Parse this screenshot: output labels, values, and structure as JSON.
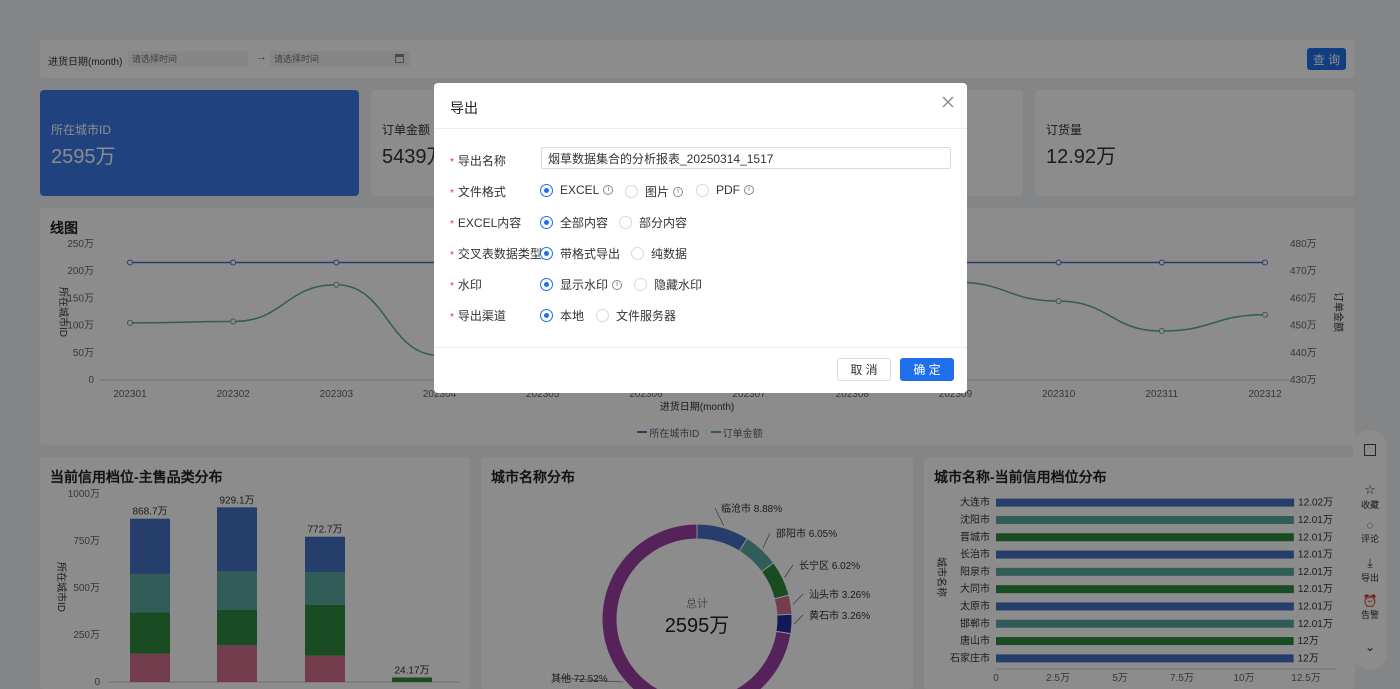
{
  "filter": {
    "label": "进货日期(month)",
    "start_placeholder": "请选择时间",
    "end_placeholder": "请选择时间",
    "arrow": "→",
    "query_button": "查 询"
  },
  "kpis": [
    {
      "label": "所在城市ID",
      "value": "2595万"
    },
    {
      "label": "订单金额",
      "value": "5439万"
    },
    {
      "label": "订货量",
      "value": "12.92万"
    }
  ],
  "line_panel": {
    "title": "线图",
    "y_left_label": "所在城市ID",
    "y_right_label": "订单金额",
    "x_label": "进货日期(month)",
    "legend": [
      "所在城市ID",
      "订单金额"
    ]
  },
  "stack_panel": {
    "title": "当前信用档位-主售品类分布",
    "y_label": "所在城市ID",
    "bar_labels": [
      "868.7万",
      "929.1万",
      "772.7万",
      "24.17万"
    ]
  },
  "donut_panel": {
    "title": "城市名称分布",
    "center_label": "总计",
    "center_value": "2595万",
    "labels": [
      "临沧市 8.88%",
      "邵阳市 6.05%",
      "长宁区 6.02%",
      "汕头市 3.26%",
      "黄石市 3.26%",
      "其他 72.52%"
    ]
  },
  "hbar_panel": {
    "title": "城市名称-当前信用档位分布",
    "y_label": "城市名称"
  },
  "side_tools": [
    {
      "icon": "edit-icon",
      "label": ""
    },
    {
      "icon": "star-icon",
      "label": "收藏"
    },
    {
      "icon": "comment-icon",
      "label": "评论"
    },
    {
      "icon": "download-icon",
      "label": "导出"
    },
    {
      "icon": "alarm-icon",
      "label": "告警"
    },
    {
      "icon": "chevron-down-icon",
      "label": ""
    }
  ],
  "modal": {
    "title": "导出",
    "fields": [
      {
        "label": "导出名称",
        "value": "烟草数据集合的分析报表_20250314_1517"
      },
      {
        "label": "文件格式",
        "options": [
          "EXCEL",
          "图片",
          "PDF"
        ],
        "selected": 0
      },
      {
        "label": "EXCEL内容",
        "options": [
          "全部内容",
          "部分内容"
        ],
        "selected": 0
      },
      {
        "label": "交叉表数据类型",
        "options": [
          "带格式导出",
          "纯数据"
        ],
        "selected": 0
      },
      {
        "label": "水印",
        "options": [
          "显示水印",
          "隐藏水印"
        ],
        "selected": 0
      },
      {
        "label": "导出渠道",
        "options": [
          "本地",
          "文件服务器"
        ],
        "selected": 0
      }
    ],
    "cancel": "取 消",
    "confirm": "确 定"
  },
  "colors": {
    "primary": "#1f6fec",
    "series_blue": "#4472c4",
    "series_teal": "#5aa89e",
    "series_green": "#2e8b3e",
    "series_pink": "#d4708f",
    "donut_purple": "#9b3fa5",
    "donut_navy": "#1f2fa0"
  },
  "chart_data": [
    {
      "type": "line",
      "title": "线图",
      "x": [
        "202301",
        "202302",
        "202303",
        "202304",
        "202305",
        "202306",
        "202307",
        "202308",
        "202309",
        "202310",
        "202311",
        "202312"
      ],
      "xlabel": "进货日期(month)",
      "ylabel": "所在城市ID",
      "y2label": "订单金额",
      "yticks": [
        "0",
        "50万",
        "100万",
        "150万",
        "200万",
        "250万"
      ],
      "y2ticks": [
        "430万",
        "440万",
        "450万",
        "460万",
        "470万",
        "480万"
      ],
      "ylim": [
        0,
        250
      ],
      "y2lim": [
        430,
        480
      ],
      "series": [
        {
          "name": "所在城市ID",
          "axis": "left",
          "values": [
            216,
            216,
            216,
            216,
            216,
            216,
            216,
            216,
            216,
            216,
            216,
            216
          ]
        },
        {
          "name": "订单金额",
          "axis": "right",
          "values": [
            451,
            451.5,
            465,
            439,
            443,
            446,
            448,
            450,
            466,
            459,
            448,
            454
          ]
        }
      ],
      "legend_position": "bottom"
    },
    {
      "type": "bar",
      "title": "当前信用档位-主售品类分布",
      "ylabel": "所在城市ID",
      "yticks": [
        "0",
        "250万",
        "500万",
        "750万",
        "1000万"
      ],
      "ylim": [
        0,
        1000
      ],
      "stacked": true,
      "totals": [
        868.7,
        929.1,
        772.7,
        24.17
      ],
      "series": [
        {
          "values": [
            150,
            195,
            140,
            0
          ]
        },
        {
          "values": [
            220,
            190,
            270,
            24.17
          ]
        },
        {
          "values": [
            205,
            205,
            175,
            0
          ]
        },
        {
          "values": [
            293.7,
            339.1,
            187.7,
            0
          ]
        }
      ]
    },
    {
      "type": "pie",
      "title": "城市名称分布",
      "slices": [
        {
          "label": "临沧市",
          "value": 8.88
        },
        {
          "label": "邵阳市",
          "value": 6.05
        },
        {
          "label": "长宁区",
          "value": 6.02
        },
        {
          "label": "汕头市",
          "value": 3.26
        },
        {
          "label": "黄石市",
          "value": 3.26
        },
        {
          "label": "其他",
          "value": 72.52
        }
      ],
      "donut": true
    },
    {
      "type": "bar",
      "orientation": "horizontal",
      "title": "城市名称-当前信用档位分布",
      "ylabel": "城市名称",
      "categories": [
        "大连市",
        "沈阳市",
        "晋城市",
        "长治市",
        "阳泉市",
        "大同市",
        "太原市",
        "邯郸市",
        "唐山市",
        "石家庄市"
      ],
      "value_labels": [
        "12.02万",
        "12.01万",
        "12.01万",
        "12.01万",
        "12.01万",
        "12.01万",
        "12.01万",
        "12.01万",
        "12万",
        "12万"
      ],
      "values": [
        12.02,
        12.01,
        12.01,
        12.01,
        12.01,
        12.01,
        12.01,
        12.01,
        12,
        12
      ],
      "xticks": [
        "0",
        "2.5万",
        "5万",
        "7.5万",
        "10万",
        "12.5万"
      ],
      "xlim": [
        0,
        12.5
      ]
    }
  ]
}
